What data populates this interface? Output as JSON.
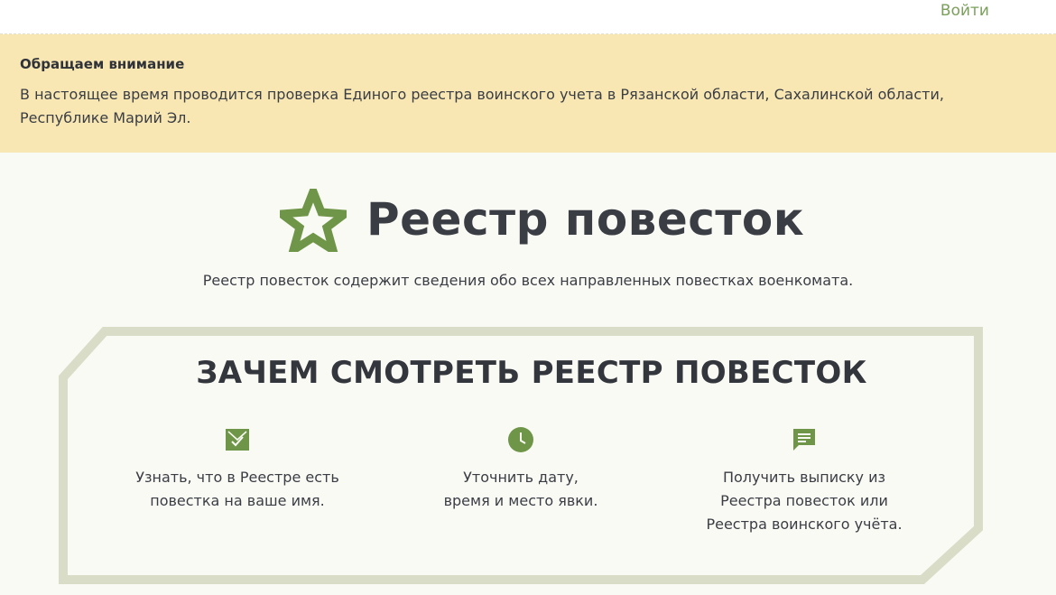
{
  "header": {
    "login_label": "Войти"
  },
  "notice": {
    "title": "Обращаем внимание",
    "text": "В настоящее время проводится проверка Единого реестра воинского учета в Рязанской области, Сахалинской области, Республике Марий Эл."
  },
  "hero": {
    "logo_icon": "army-star-icon",
    "title": "Реестр повесток",
    "subtitle": "Реестр повесток содержит сведения обо всех направленных повестках военкомата."
  },
  "why": {
    "title": "ЗАЧЕМ СМОТРЕТЬ РЕЕСТР ПОВЕСТОК",
    "features": [
      {
        "icon": "checkmark-mail-icon",
        "line1": "Узнать, что в Реестре есть",
        "line2": "повестка на ваше имя.",
        "line3": ""
      },
      {
        "icon": "clock-icon",
        "line1": "Уточнить дату,",
        "line2": "время и место явки.",
        "line3": ""
      },
      {
        "icon": "message-icon",
        "line1": "Получить выписку из",
        "line2": "Реестра повесток или",
        "line3": "Реестра воинского учёта."
      }
    ]
  },
  "colors": {
    "accent_green": "#6f9648",
    "notice_bg": "#f8e7b3",
    "frame": "#d9dcc6",
    "page_bg": "#fafaf5"
  }
}
